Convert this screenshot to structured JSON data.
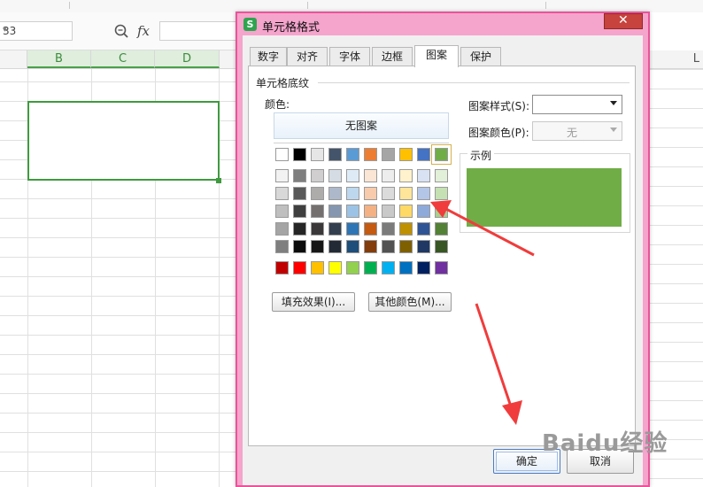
{
  "spreadsheet": {
    "name_box": "33",
    "fx_label": "fx",
    "columns": [
      "B",
      "C",
      "D"
    ],
    "right_column": "L"
  },
  "dialog": {
    "title": "单元格格式",
    "app_icon_letter": "S",
    "close_symbol": "✕",
    "tabs": [
      {
        "label": "数字",
        "active": false
      },
      {
        "label": "对齐",
        "active": false
      },
      {
        "label": "字体",
        "active": false
      },
      {
        "label": "边框",
        "active": false
      },
      {
        "label": "图案",
        "active": true
      },
      {
        "label": "保护",
        "active": false
      }
    ],
    "group_label": "单元格底纹",
    "color_label": "颜色:",
    "no_pattern_label": "无图案",
    "palette": {
      "theme_row": [
        "#ffffff",
        "#000000",
        "#e7e6e6",
        "#44546a",
        "#5b9bd5",
        "#ed7d31",
        "#a5a5a5",
        "#ffc000",
        "#4472c4",
        "#70ad47"
      ],
      "tint_rows": [
        [
          "#f2f2f2",
          "#7f7f7f",
          "#d0cece",
          "#d6dce4",
          "#deebf6",
          "#fbe5d5",
          "#ededed",
          "#fff2cc",
          "#d9e2f3",
          "#e2efd9"
        ],
        [
          "#d8d8d8",
          "#595959",
          "#aeabab",
          "#adb9ca",
          "#bdd7ee",
          "#f7cbac",
          "#dbdbdb",
          "#fee599",
          "#b4c6e7",
          "#c5e0b3"
        ],
        [
          "#bfbfbf",
          "#3f3f3f",
          "#757070",
          "#8496b0",
          "#9cc3e5",
          "#f4b183",
          "#c9c9c9",
          "#ffd965",
          "#8eaadb",
          "#a8d08d"
        ],
        [
          "#a5a5a5",
          "#262626",
          "#3a3838",
          "#333f4f",
          "#2e75b5",
          "#c55a11",
          "#7b7b7b",
          "#bf9000",
          "#2f5496",
          "#538135"
        ],
        [
          "#7f7f7f",
          "#0c0c0c",
          "#171616",
          "#222a35",
          "#1e4e79",
          "#833c0b",
          "#525252",
          "#7f6000",
          "#1f3864",
          "#375623"
        ]
      ],
      "standard_row": [
        "#c00000",
        "#ff0000",
        "#ffc000",
        "#ffff00",
        "#92d050",
        "#00b050",
        "#00b0f0",
        "#0070c0",
        "#002060",
        "#7030a0"
      ],
      "selected_color": "#70ad47"
    },
    "fill_effects_button": "填充效果(I)...",
    "more_colors_button": "其他颜色(M)...",
    "pattern_style_label": "图案样式(S):",
    "pattern_color_label": "图案颜色(P):",
    "pattern_color_value": "无",
    "sample_label": "示例",
    "ok_button": "确定",
    "cancel_button": "取消"
  },
  "watermark": "Baidu经验",
  "accent_colors": {
    "dialog_border": "#e8549a",
    "title_bar": "#f5a4cc",
    "selection_green": "#3f9a3f",
    "annotation_arrow": "#f03c3c"
  }
}
